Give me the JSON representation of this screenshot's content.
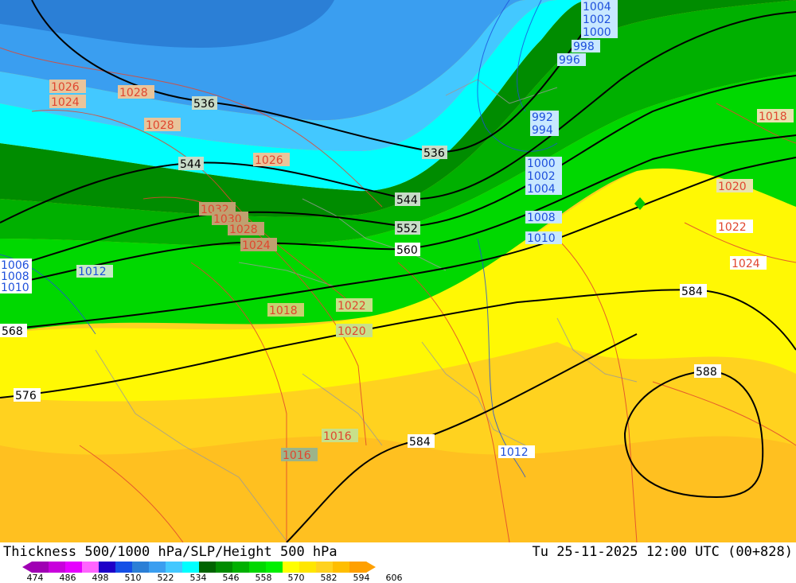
{
  "map": {
    "title": "Thickness 500/1000 hPa/SLP/Height 500 hPa",
    "timestamp": "Tu 25-11-2025 12:00 UTC (00+828)",
    "colors": {
      "thickness_bands": [
        "#2b7fd6",
        "#3a9ef0",
        "#43c8ff",
        "#00ffff",
        "#008c00",
        "#00b000",
        "#00d800",
        "#ffff00",
        "#ffd21f",
        "#ffb400"
      ]
    },
    "height_labels": [
      "536",
      "536",
      "544",
      "544",
      "552",
      "560",
      "568",
      "576",
      "584",
      "584",
      "588"
    ],
    "slp_labels_red": [
      "1026",
      "1024",
      "1028",
      "1028",
      "1026",
      "1032",
      "1030",
      "1028",
      "1024",
      "1018",
      "1022",
      "1020",
      "1016",
      "1016",
      "1018",
      "1020",
      "1022",
      "1024"
    ],
    "slp_labels_blue": [
      "1004",
      "1002",
      "1000",
      "998",
      "996",
      "992",
      "994",
      "1000",
      "1002",
      "1004",
      "1008",
      "1010",
      "1006",
      "1008",
      "1010",
      "1012",
      "1012"
    ],
    "scale": {
      "colors": [
        "#a000b4",
        "#c800dc",
        "#e600ff",
        "#ff64ff",
        "#1e00c8",
        "#1450e6",
        "#2b7fd6",
        "#3a9ef0",
        "#43c8ff",
        "#00ffff",
        "#006400",
        "#008c00",
        "#00b000",
        "#00d800",
        "#00f000",
        "#ffff00",
        "#ffe600",
        "#ffd21f",
        "#ffbe00",
        "#ffa000"
      ],
      "ticks": [
        "474",
        "486",
        "498",
        "510",
        "522",
        "534",
        "546",
        "558",
        "570",
        "582",
        "594",
        "606"
      ]
    }
  }
}
